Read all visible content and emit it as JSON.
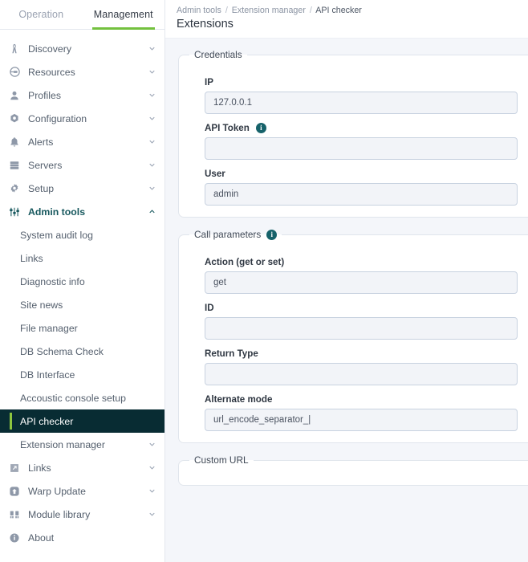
{
  "colors": {
    "accent_green": "#73c13e",
    "selected_bg": "#082c33",
    "selected_bar": "#8dc63f",
    "open_teal": "#17585e",
    "page_bg": "#f4f6fa",
    "info_teal": "#16626a"
  },
  "sidebar": {
    "tabs": [
      {
        "label": "Operation",
        "active": false
      },
      {
        "label": "Management",
        "active": true
      }
    ],
    "items": [
      {
        "label": "Discovery",
        "icon": "discovery-icon",
        "chevron": "down"
      },
      {
        "label": "Resources",
        "icon": "resources-icon",
        "chevron": "down"
      },
      {
        "label": "Profiles",
        "icon": "profiles-icon",
        "chevron": "down"
      },
      {
        "label": "Configuration",
        "icon": "configuration-icon",
        "chevron": "down"
      },
      {
        "label": "Alerts",
        "icon": "alerts-bell-icon",
        "chevron": "down"
      },
      {
        "label": "Servers",
        "icon": "servers-icon",
        "chevron": "down"
      },
      {
        "label": "Setup",
        "icon": "setup-gear-icon",
        "chevron": "down"
      },
      {
        "label": "Admin tools",
        "icon": "admin-tools-sliders-icon",
        "chevron": "up",
        "open": true
      }
    ],
    "admin_tools_children": [
      {
        "label": "System audit log"
      },
      {
        "label": "Links"
      },
      {
        "label": "Diagnostic info"
      },
      {
        "label": "Site news"
      },
      {
        "label": "File manager"
      },
      {
        "label": "DB Schema Check"
      },
      {
        "label": "DB Interface"
      },
      {
        "label": "Accoustic console setup"
      },
      {
        "label": "API checker",
        "selected": true
      },
      {
        "label": "Extension manager",
        "chevron": "down"
      }
    ],
    "bottom_items": [
      {
        "label": "Links",
        "icon": "external-link-icon",
        "chevron": "down"
      },
      {
        "label": "Warp Update",
        "icon": "warp-update-icon",
        "chevron": "down"
      },
      {
        "label": "Module library",
        "icon": "module-library-icon",
        "chevron": "down"
      },
      {
        "label": "About",
        "icon": "about-info-icon",
        "chevron": "none"
      }
    ]
  },
  "header": {
    "breadcrumb": {
      "root": "Admin tools",
      "mid": "Extension manager",
      "current": "API checker",
      "separator": "/"
    },
    "title": "Extensions"
  },
  "form": {
    "credentials": {
      "legend": "Credentials",
      "fields": [
        {
          "label": "IP",
          "value": "127.0.0.1",
          "placeholder": "",
          "info": false
        },
        {
          "label": "API Token",
          "value": "",
          "placeholder": "",
          "info": true
        },
        {
          "label": "User",
          "value": "admin",
          "placeholder": "",
          "info": false
        }
      ]
    },
    "call_parameters": {
      "legend": "Call parameters",
      "legend_info": true,
      "fields": [
        {
          "label": "Action (get or set)",
          "value": "get",
          "placeholder": ""
        },
        {
          "label": "ID",
          "value": "",
          "placeholder": ""
        },
        {
          "label": "Return Type",
          "value": "",
          "placeholder": ""
        },
        {
          "label": "Alternate mode",
          "value": "url_encode_separator_|",
          "placeholder": ""
        }
      ]
    },
    "custom_url": {
      "legend": "Custom URL"
    }
  }
}
